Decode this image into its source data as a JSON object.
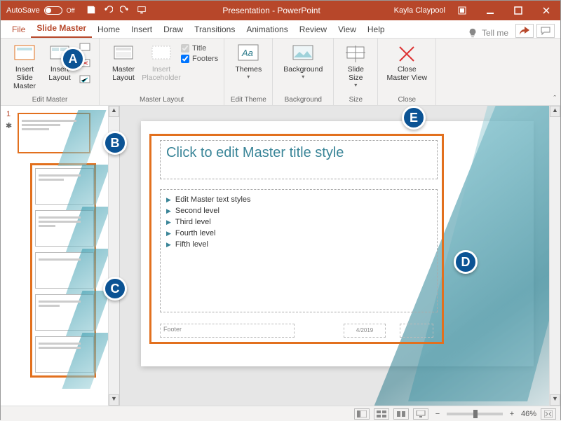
{
  "titlebar": {
    "autosave_label": "AutoSave",
    "autosave_state": "Off",
    "title": "Presentation - PowerPoint",
    "user": "Kayla Claypool"
  },
  "tabs": {
    "file": "File",
    "slide_master": "Slide Master",
    "home": "Home",
    "insert": "Insert",
    "draw": "Draw",
    "transitions": "Transitions",
    "animations": "Animations",
    "review": "Review",
    "view": "View",
    "help": "Help",
    "tell_me": "Tell me"
  },
  "ribbon": {
    "edit_master_group": "Edit Master",
    "master_layout_group": "Master Layout",
    "edit_theme_group": "Edit Theme",
    "background_group": "Background",
    "size_group": "Size",
    "close_group": "Close",
    "insert_slide_master": "Insert Slide\nMaster",
    "insert_layout": "Insert\nLayout",
    "master_layout": "Master\nLayout",
    "insert_placeholder": "Insert\nPlaceholder",
    "chk_title": "Title",
    "chk_footers": "Footers",
    "themes": "Themes",
    "background": "Background",
    "slide_size": "Slide\nSize",
    "close_master_view": "Close\nMaster View"
  },
  "slide": {
    "title_placeholder": "Click to edit Master title style",
    "lvl1": "Edit Master text styles",
    "lvl2": "Second level",
    "lvl3": "Third level",
    "lvl4": "Fourth level",
    "lvl5": "Fifth level",
    "footer": "Footer",
    "date": "4/2019"
  },
  "thumbs": {
    "slide_number": "1"
  },
  "statusbar": {
    "zoom_pct": "46%"
  },
  "badges": {
    "a": "A",
    "b": "B",
    "c": "C",
    "d": "D",
    "e": "E"
  }
}
